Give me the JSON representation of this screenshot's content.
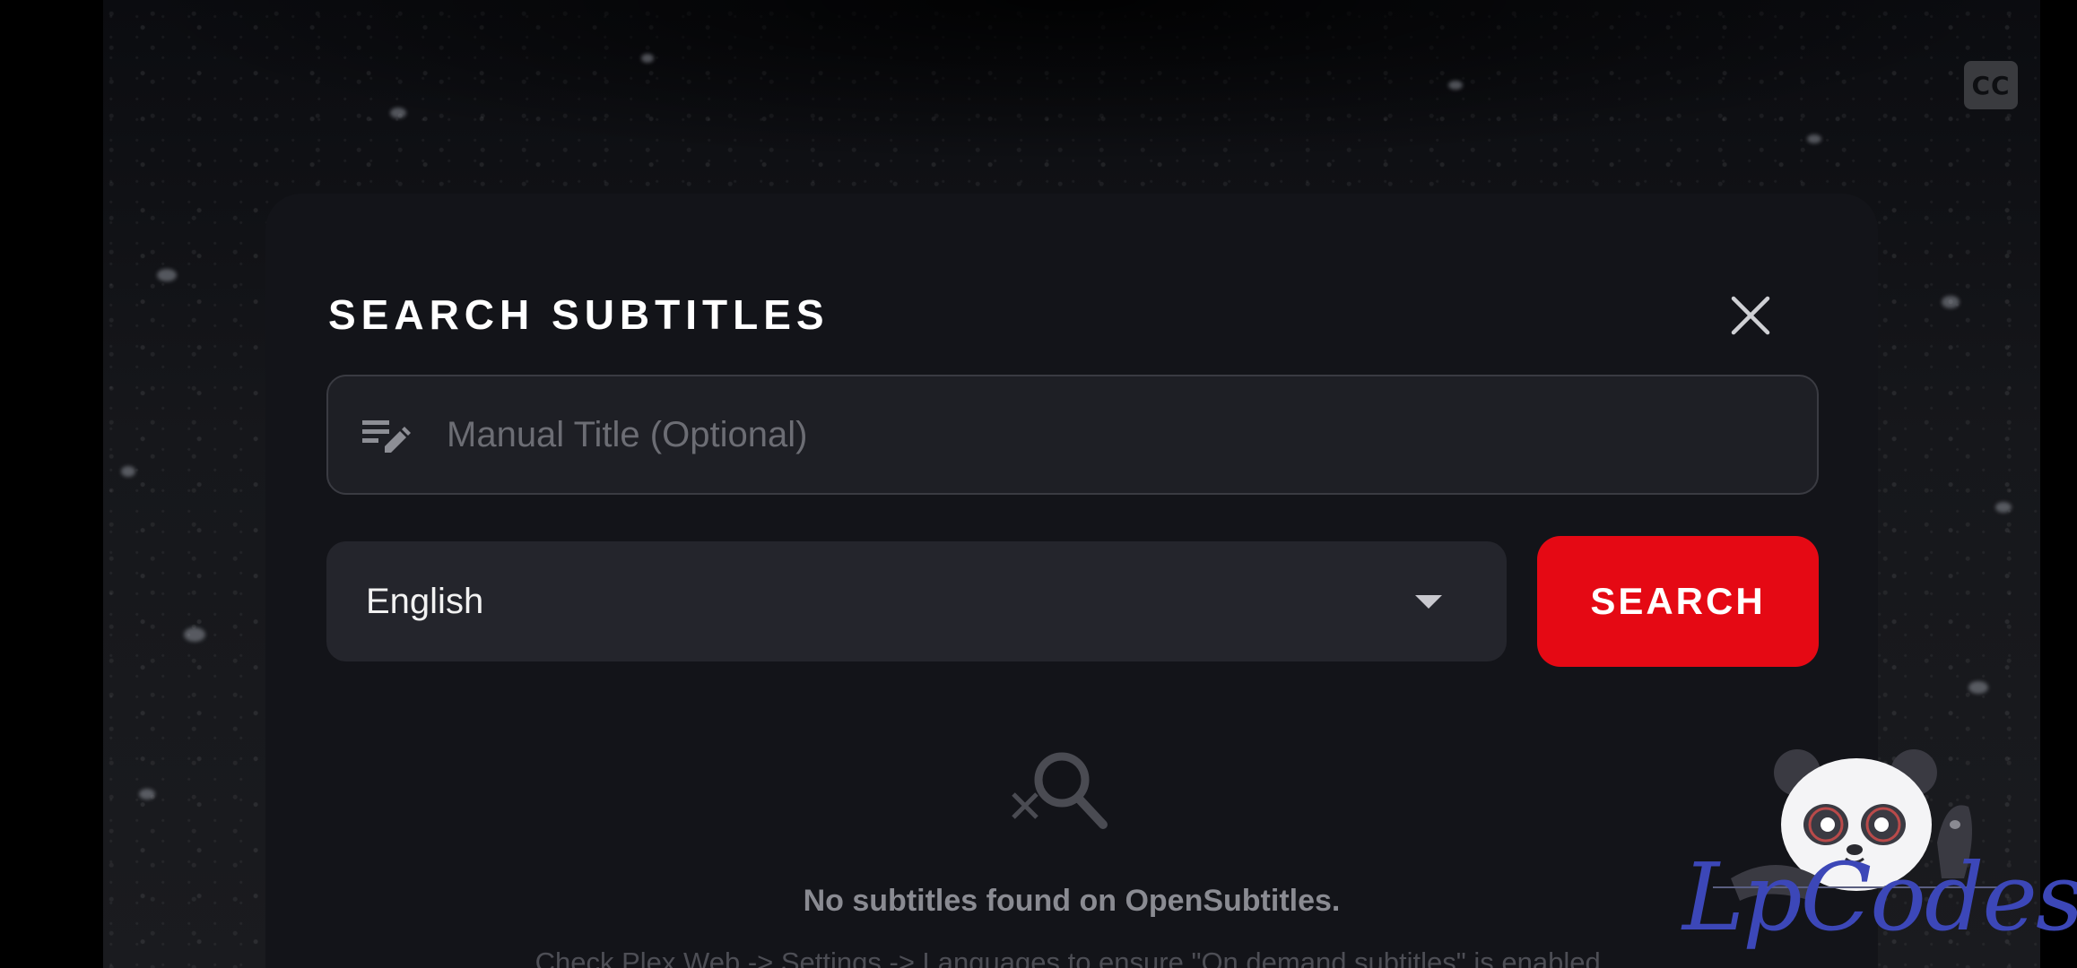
{
  "player": {
    "cc_label": "CC"
  },
  "dialog": {
    "title": "SEARCH SUBTITLES",
    "close_icon": "close-icon",
    "title_input": {
      "value": "",
      "placeholder": "Manual Title (Optional)",
      "icon": "edit-notes-icon"
    },
    "language": {
      "selected": "English",
      "icon": "chevron-down-icon"
    },
    "search_label": "SEARCH",
    "empty_state": {
      "icon": "search-off-icon",
      "message": "No subtitles found on OpenSubtitles.",
      "hint": "Check Plex Web -> Settings -> Languages to ensure \"On demand subtitles\" is enabled."
    }
  },
  "watermark": {
    "text": "LpCodes"
  },
  "colors": {
    "accent": "#e50914",
    "dialog_bg": "#131419",
    "field_bg": "#1e1f25"
  }
}
